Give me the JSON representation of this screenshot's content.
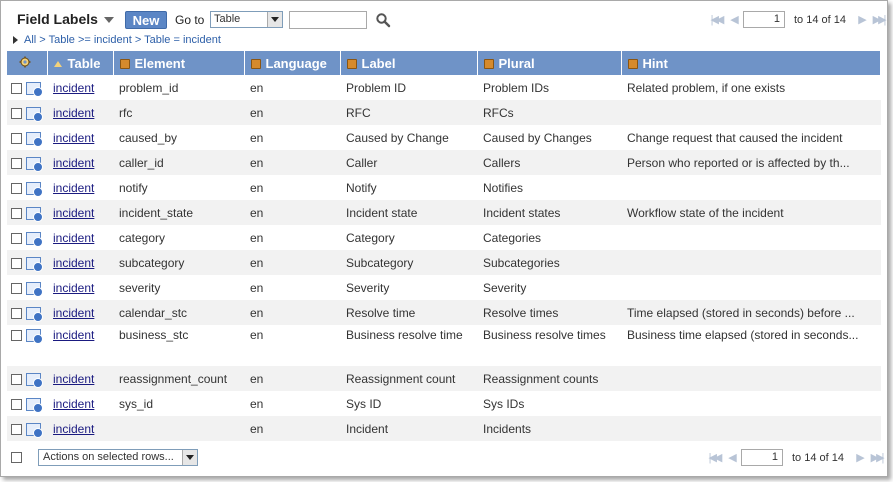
{
  "toolbar": {
    "title": "Field Labels",
    "new_label": "New",
    "goto_label": "Go to",
    "goto_selected": "Table",
    "search_value": ""
  },
  "pager_top": {
    "page": "1",
    "range": "to 14 of 14"
  },
  "pager_bottom": {
    "page": "1",
    "range": "to 14 of 14"
  },
  "breadcrumb": {
    "all": "All",
    "sep1": ">",
    "filter1": "Table >= incident",
    "sep2": ">",
    "filter2": "Table = incident"
  },
  "columns": {
    "table": "Table",
    "element": "Element",
    "language": "Language",
    "label": "Label",
    "plural": "Plural",
    "hint": "Hint"
  },
  "rows": [
    {
      "table": "incident",
      "element": "problem_id",
      "language": "en",
      "label": "Problem ID",
      "plural": "Problem IDs",
      "hint": "Related problem, if one exists"
    },
    {
      "table": "incident",
      "element": "rfc",
      "language": "en",
      "label": "RFC",
      "plural": "RFCs",
      "hint": ""
    },
    {
      "table": "incident",
      "element": "caused_by",
      "language": "en",
      "label": "Caused by Change",
      "plural": "Caused by Changes",
      "hint": "Change request that caused the incident"
    },
    {
      "table": "incident",
      "element": "caller_id",
      "language": "en",
      "label": "Caller",
      "plural": "Callers",
      "hint": "Person who reported or is affected by th..."
    },
    {
      "table": "incident",
      "element": "notify",
      "language": "en",
      "label": "Notify",
      "plural": "Notifies",
      "hint": ""
    },
    {
      "table": "incident",
      "element": "incident_state",
      "language": "en",
      "label": "Incident state",
      "plural": "Incident states",
      "hint": "Workflow state of the incident"
    },
    {
      "table": "incident",
      "element": "category",
      "language": "en",
      "label": "Category",
      "plural": "Categories",
      "hint": ""
    },
    {
      "table": "incident",
      "element": "subcategory",
      "language": "en",
      "label": "Subcategory",
      "plural": "Subcategories",
      "hint": ""
    },
    {
      "table": "incident",
      "element": "severity",
      "language": "en",
      "label": "Severity",
      "plural": "Severity",
      "hint": ""
    },
    {
      "table": "incident",
      "element": "calendar_stc",
      "language": "en",
      "label": "Resolve time",
      "plural": "Resolve times",
      "hint": "Time elapsed (stored in seconds) before ..."
    },
    {
      "table": "incident",
      "element": "business_stc",
      "language": "en",
      "label": "Business resolve time",
      "plural": "Business resolve times",
      "hint": "Business time elapsed (stored in seconds...",
      "tall": true
    },
    {
      "table": "incident",
      "element": "reassignment_count",
      "language": "en",
      "label": "Reassignment count",
      "plural": "Reassignment counts",
      "hint": ""
    },
    {
      "table": "incident",
      "element": "sys_id",
      "language": "en",
      "label": "Sys ID",
      "plural": "Sys IDs",
      "hint": ""
    },
    {
      "table": "incident",
      "element": "",
      "language": "en",
      "label": "Incident",
      "plural": "Incidents",
      "hint": ""
    }
  ],
  "footer": {
    "actions_label": "Actions on selected rows..."
  },
  "colors": {
    "header_bg": "#6f93c7",
    "new_button": "#5b86c5",
    "link": "#2d5fa8"
  },
  "icons": {
    "search": "search-icon",
    "settings": "gear-icon",
    "row": "record-preview-icon"
  }
}
